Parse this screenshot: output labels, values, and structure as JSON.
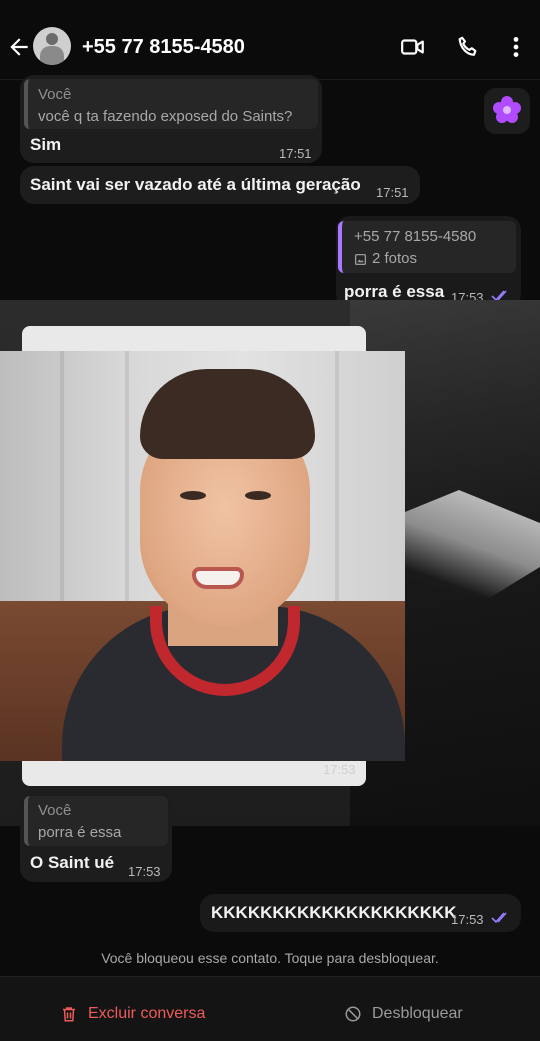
{
  "header": {
    "contact": "+55 77 8155-4580",
    "icons": [
      "back-arrow-icon",
      "avatar",
      "video-call-icon",
      "phone-icon",
      "more-vert-icon"
    ]
  },
  "messages": {
    "m1": {
      "quote_name": "Você",
      "quote_text": "você q ta fazendo exposed do Saints?",
      "text": "Sim",
      "time": "17:51"
    },
    "m2": {
      "text": "Saint vai ser vazado até a última geração",
      "time": "17:51"
    },
    "m3": {
      "quote_name": "+55 77 8155-4580",
      "quote_text": "2 fotos",
      "text": "porra é essa",
      "time": "17:53"
    },
    "photo": {
      "time": "17:53"
    },
    "m4": {
      "quote_name": "Você",
      "quote_text": "porra é essa",
      "text": "O Saint ué",
      "time": "17:53"
    },
    "m5": {
      "text": "KKKKKKKKKKKKKKKKKKKK",
      "time": "17:53"
    }
  },
  "notice": "Você bloqueou esse contato. Toque para desbloquear.",
  "bottom": {
    "delete_label": "Excluir conversa",
    "unblock_label": "Desbloquear"
  },
  "colors": {
    "accent_purple": "#a978ff",
    "delete_red": "#ef5a5a",
    "read_check": "#9b7bff"
  }
}
